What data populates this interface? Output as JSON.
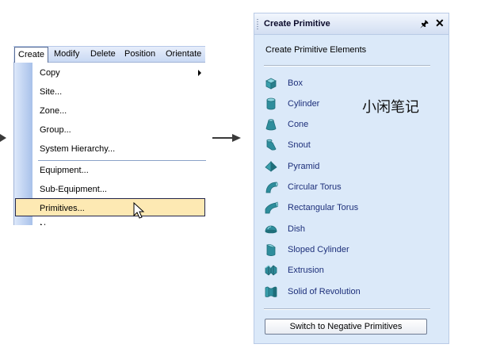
{
  "menubar": {
    "items": [
      "Create",
      "Modify",
      "Delete",
      "Position",
      "Orientate"
    ]
  },
  "dropdown": {
    "items": [
      {
        "label": "Copy",
        "has_submenu": true
      },
      {
        "label": "Site..."
      },
      {
        "label": "Zone..."
      },
      {
        "label": "Group..."
      },
      {
        "label": "System Hierarchy..."
      },
      {
        "label": "Equipment..."
      },
      {
        "label": "Sub-Equipment..."
      },
      {
        "label": "Primitives...",
        "highlighted": true
      },
      {
        "label": "N..."
      }
    ]
  },
  "panel": {
    "title": "Create Primitive",
    "subheading": "Create Primitive Elements",
    "items": [
      {
        "label": "Box",
        "icon": "box-icon"
      },
      {
        "label": "Cylinder",
        "icon": "cylinder-icon"
      },
      {
        "label": "Cone",
        "icon": "cone-icon"
      },
      {
        "label": "Snout",
        "icon": "snout-icon"
      },
      {
        "label": "Pyramid",
        "icon": "pyramid-icon"
      },
      {
        "label": "Circular Torus",
        "icon": "circular-torus-icon"
      },
      {
        "label": "Rectangular Torus",
        "icon": "rectangular-torus-icon"
      },
      {
        "label": "Dish",
        "icon": "dish-icon"
      },
      {
        "label": "Sloped Cylinder",
        "icon": "sloped-cylinder-icon"
      },
      {
        "label": "Extrusion",
        "icon": "extrusion-icon"
      },
      {
        "label": "Solid of Revolution",
        "icon": "solid-of-revolution-icon"
      }
    ],
    "negative_button": "Switch to Negative Primitives"
  },
  "watermark": "小闲笔记",
  "colors": {
    "highlight": "#fde9b3",
    "panel_bg": "#dbe9f9",
    "icon_teal": "#2e8d9c",
    "link_text": "#1d2f7a"
  }
}
